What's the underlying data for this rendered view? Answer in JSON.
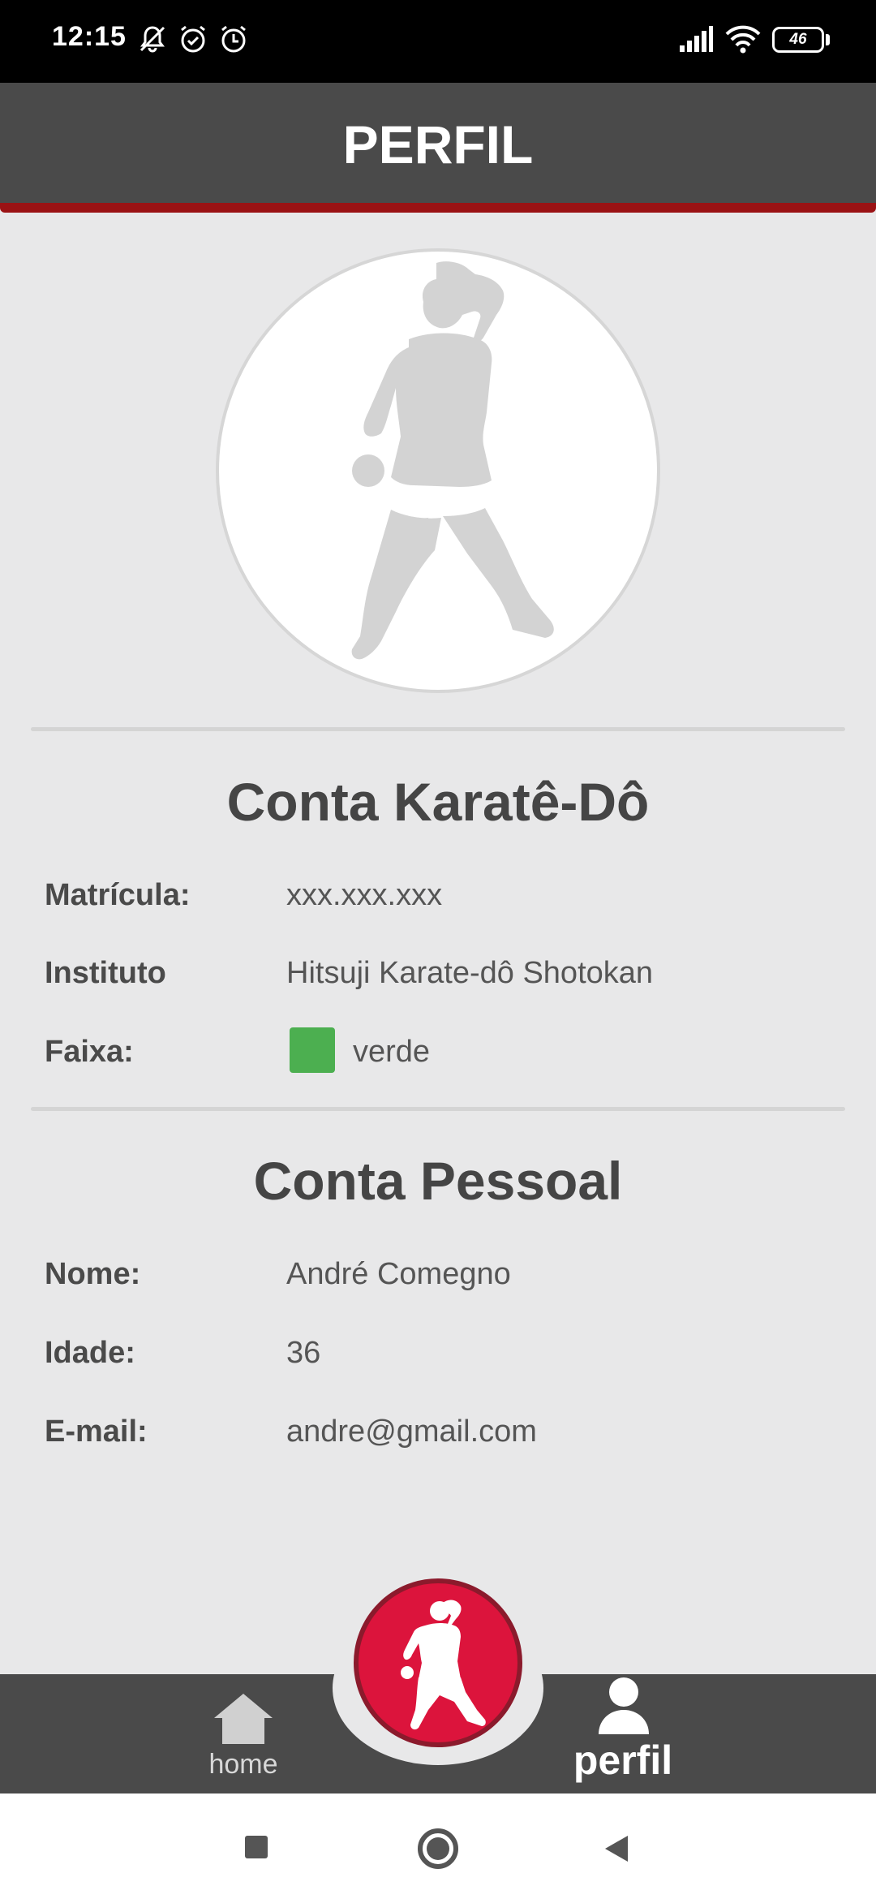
{
  "status_bar": {
    "time": "12:15",
    "battery": "46"
  },
  "header": {
    "title": "PERFIL"
  },
  "karate_section": {
    "title": "Conta Karatê-Dô",
    "rows": [
      {
        "label": "Matrícula:",
        "value": "xxx.xxx.xxx"
      },
      {
        "label": "Instituto",
        "value": "Hitsuji Karate-dô Shotokan"
      },
      {
        "label": "Faixa:",
        "value": "verde",
        "swatch_color": "#4caf50"
      }
    ]
  },
  "personal_section": {
    "title": "Conta Pessoal",
    "rows": [
      {
        "label": "Nome:",
        "value": "André Comegno"
      },
      {
        "label": "Idade:",
        "value": "36"
      },
      {
        "label": "E-mail:",
        "value": "andre@gmail.com"
      }
    ]
  },
  "bottom_nav": {
    "home_label": "home",
    "perfil_label": "perfil",
    "active_tab": "perfil",
    "fab_icon": "karate-fighter-icon"
  },
  "colors": {
    "header": "#4a4a4a",
    "accent": "#9a1214",
    "fab": "#dc143c",
    "background": "#e8e8e9"
  }
}
